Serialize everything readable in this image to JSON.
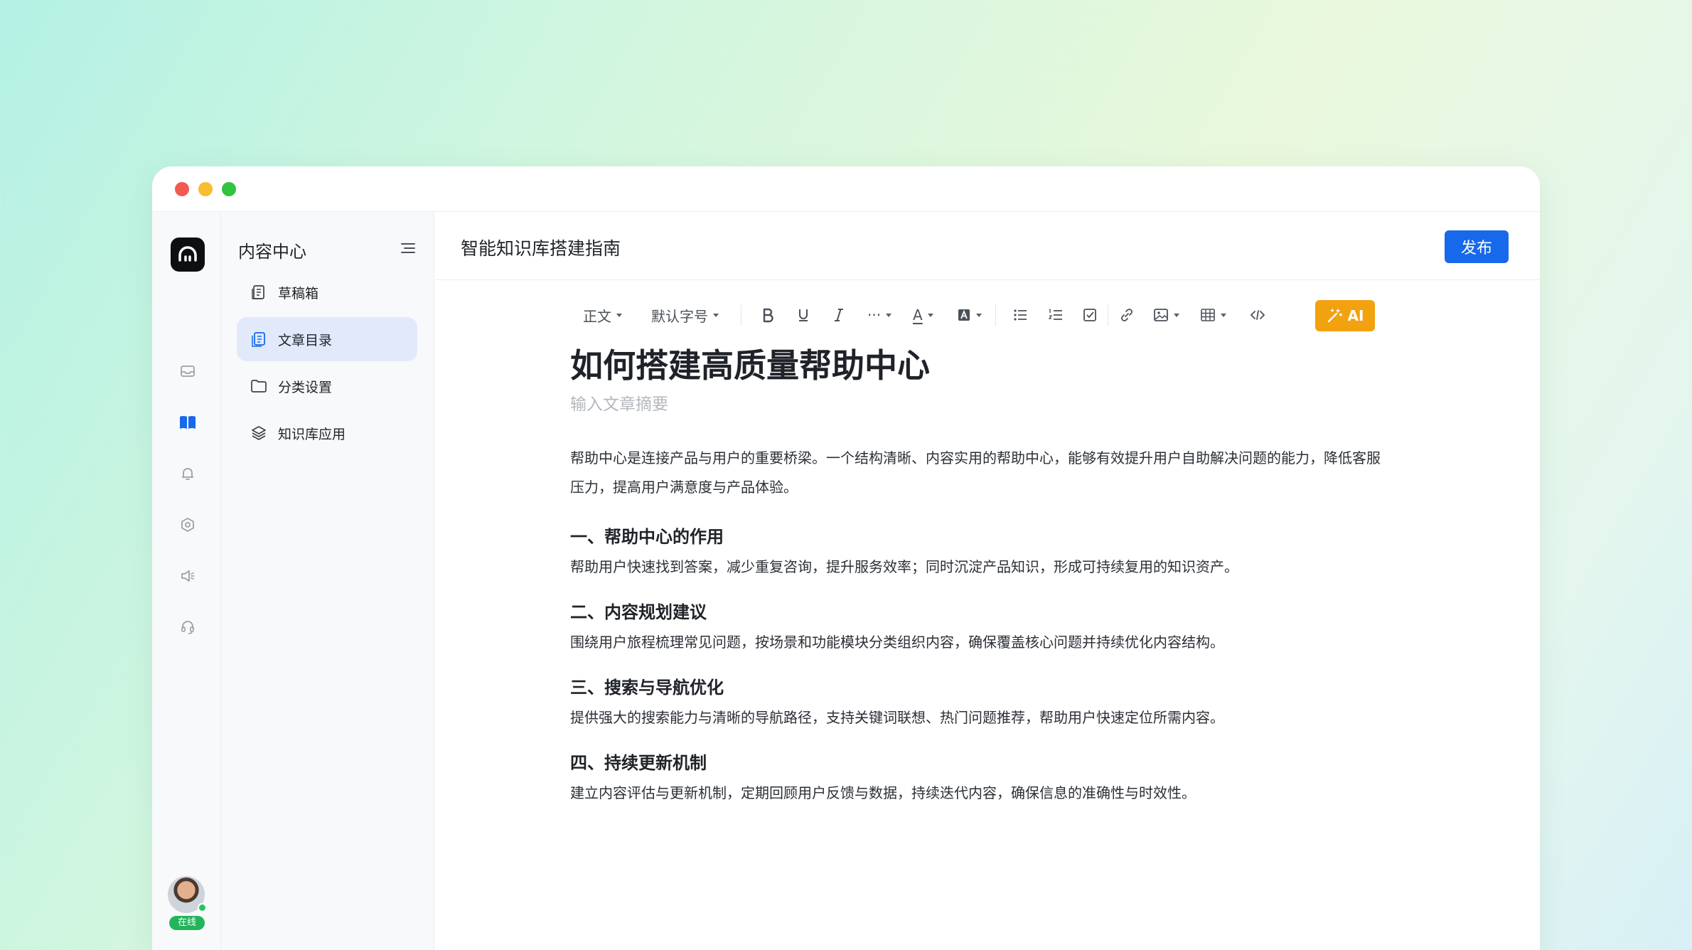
{
  "sidebar": {
    "title": "内容中心",
    "items": [
      {
        "label": "草稿箱",
        "icon": "drafts-icon"
      },
      {
        "label": "文章目录",
        "icon": "catalog-icon",
        "active": true
      },
      {
        "label": "分类设置",
        "icon": "folder-icon"
      },
      {
        "label": "知识库应用",
        "icon": "layers-icon"
      }
    ]
  },
  "rail": {
    "icons": [
      "inbox-icon",
      "book-icon",
      "bell-icon",
      "settings-icon",
      "speaker-icon",
      "headset-icon"
    ],
    "user_status": "在线"
  },
  "header": {
    "doc_title": "智能知识库搭建指南",
    "publish_label": "发布"
  },
  "toolbar": {
    "paragraph_style": "正文",
    "font_size": "默认字号",
    "more_label": "···",
    "text_color_label": "A",
    "ai_label": "AI"
  },
  "article": {
    "title": "如何搭建高质量帮助中心",
    "summary_placeholder": "输入文章摘要",
    "intro": "帮助中心是连接产品与用户的重要桥梁。一个结构清晰、内容实用的帮助中心，能够有效提升用户自助解决问题的能力，降低客服压力，提高用户满意度与产品体验。",
    "sections": [
      {
        "heading": "一、帮助中心的作用",
        "body": "帮助用户快速找到答案，减少重复咨询，提升服务效率；同时沉淀产品知识，形成可持续复用的知识资产。"
      },
      {
        "heading": "二、内容规划建议",
        "body": "围绕用户旅程梳理常见问题，按场景和功能模块分类组织内容，确保覆盖核心问题并持续优化内容结构。"
      },
      {
        "heading": "三、搜索与导航优化",
        "body": "提供强大的搜索能力与清晰的导航路径，支持关键词联想、热门问题推荐，帮助用户快速定位所需内容。"
      },
      {
        "heading": "四、持续更新机制",
        "body": "建立内容评估与更新机制，定期回顾用户反馈与数据，持续迭代内容，确保信息的准确性与时效性。"
      }
    ]
  },
  "colors": {
    "accent": "#1769ec",
    "ai": "#f2a10f",
    "active_nav": "#e2e9fb"
  }
}
